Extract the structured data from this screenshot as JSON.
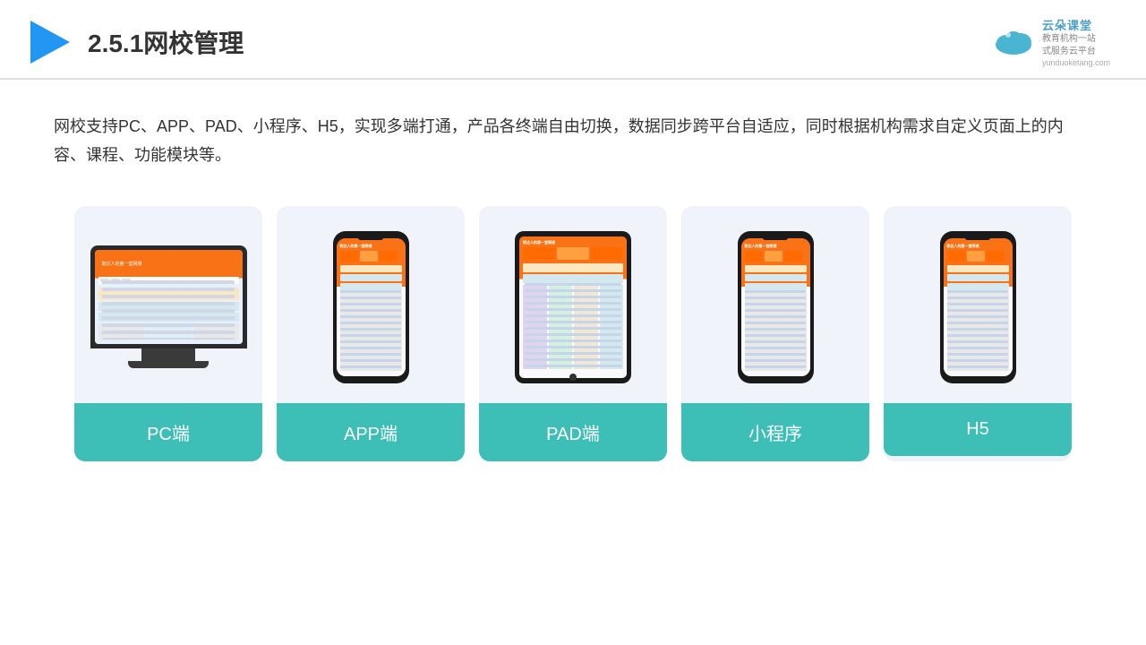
{
  "header": {
    "title": "2.5.1网校管理",
    "brand_name": "云朵课堂",
    "brand_url": "yunduoketang.com",
    "brand_slogan": "教育机构一站\n式服务云平台"
  },
  "description": {
    "text": "网校支持PC、APP、PAD、小程序、H5，实现多端打通，产品各终端自由切换，数据同步跨平台自适应，同时根据机构需求自定义页面上的内容、课程、功能模块等。"
  },
  "cards": [
    {
      "id": "pc",
      "label": "PC端",
      "type": "pc"
    },
    {
      "id": "app",
      "label": "APP端",
      "type": "phone"
    },
    {
      "id": "pad",
      "label": "PAD端",
      "type": "tablet"
    },
    {
      "id": "miniprogram",
      "label": "小程序",
      "type": "phone"
    },
    {
      "id": "h5",
      "label": "H5",
      "type": "phone"
    }
  ]
}
